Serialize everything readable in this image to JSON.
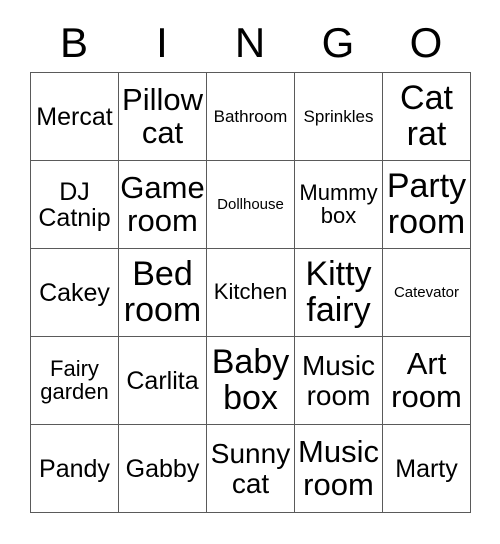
{
  "card": {
    "type": "bingo-card",
    "columns": 5,
    "rows": 5,
    "border_color": "#5a5a5a",
    "background_color": "#ffffff",
    "text_color": "#000000"
  },
  "header": {
    "letters": [
      "B",
      "I",
      "N",
      "G",
      "O"
    ]
  },
  "grid": {
    "rows": [
      [
        {
          "text": "Mercat",
          "size": "m"
        },
        {
          "text": "Pillow\ncat",
          "size": "xl"
        },
        {
          "text": "Bathroom",
          "size": "xs"
        },
        {
          "text": "Sprinkles",
          "size": "xs"
        },
        {
          "text": "Cat\nrat",
          "size": "xxl"
        }
      ],
      [
        {
          "text": "DJ\nCatnip",
          "size": "m"
        },
        {
          "text": "Game\nroom",
          "size": "xl"
        },
        {
          "text": "Dollhouse",
          "size": "xxs"
        },
        {
          "text": "Mummy\nbox",
          "size": "s"
        },
        {
          "text": "Party\nroom",
          "size": "xxl"
        }
      ],
      [
        {
          "text": "Cakey",
          "size": "m"
        },
        {
          "text": "Bed\nroom",
          "size": "xxl"
        },
        {
          "text": "Kitchen",
          "size": "s"
        },
        {
          "text": "Kitty\nfairy",
          "size": "xxl"
        },
        {
          "text": "Catevator",
          "size": "xxs"
        }
      ],
      [
        {
          "text": "Fairy\ngarden",
          "size": "s"
        },
        {
          "text": "Carlita",
          "size": "m"
        },
        {
          "text": "Baby\nbox",
          "size": "xxl"
        },
        {
          "text": "Music\nroom",
          "size": "l"
        },
        {
          "text": "Art\nroom",
          "size": "xl"
        }
      ],
      [
        {
          "text": "Pandy",
          "size": "m"
        },
        {
          "text": "Gabby",
          "size": "m"
        },
        {
          "text": "Sunny\ncat",
          "size": "l"
        },
        {
          "text": "Music\nroom",
          "size": "xl"
        },
        {
          "text": "Marty",
          "size": "m"
        }
      ]
    ]
  }
}
